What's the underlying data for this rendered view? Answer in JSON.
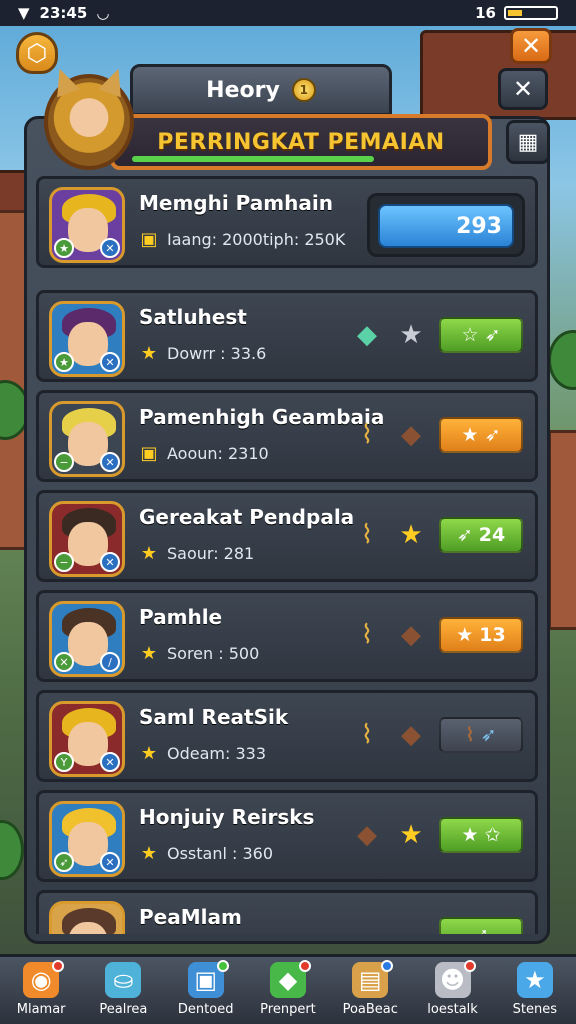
{
  "status_bar": {
    "left": "23:45",
    "right": "16"
  },
  "header": {
    "tab_title": "Heory",
    "tab_coin": "1",
    "banner_title": "PERRINGKAT PEMAIAN"
  },
  "players": [
    {
      "name": "Memghi Pamhain",
      "stat_label": "Iaang: 2000tiph: 250K",
      "score": "293",
      "hair": "#e7b51d"
    },
    {
      "name": "Satluhest",
      "stat_label": "Dowrr : 33.6",
      "pill": "",
      "hair": "#5b2a6a"
    },
    {
      "name": "Pamenhigh Geambaia",
      "stat_label": "Aooun: 2310",
      "pill": "",
      "hair": "#e6d04a"
    },
    {
      "name": "Gereakat Pendpala",
      "stat_label": "Saour: 281",
      "pill": "24",
      "hair": "#3a2a22"
    },
    {
      "name": "Pamhle",
      "stat_label": "Soren : 500",
      "pill": "13",
      "hair": "#4a3224"
    },
    {
      "name": "Saml ReatSik",
      "stat_label": "Odeam: 333",
      "pill": "",
      "hair": "#e7b51d"
    },
    {
      "name": "Honjuiy Reirsks",
      "stat_label": "Osstanl : 360",
      "pill": "",
      "hair": "#f1c02d"
    },
    {
      "name": "PeaMlam",
      "stat_label": "",
      "pill": "",
      "hair": "#5a3a2a"
    }
  ],
  "nav": [
    {
      "label": "Mlamar",
      "icon": "camera-icon",
      "glyph": "◉",
      "color": "#f08a2a"
    },
    {
      "label": "Pealrea",
      "icon": "pot-icon",
      "glyph": "⛀",
      "color": "#4fb3d9"
    },
    {
      "label": "Dentoed",
      "icon": "map-icon",
      "glyph": "▣",
      "color": "#3f8fd6"
    },
    {
      "label": "Prenpert",
      "icon": "gem-icon",
      "glyph": "◆",
      "color": "#48b848"
    },
    {
      "label": "PoaBeac",
      "icon": "scroll-icon",
      "glyph": "▤",
      "color": "#d9a14a"
    },
    {
      "label": "loestalk",
      "icon": "pet-icon",
      "glyph": "☻",
      "color": "#d8d8d8"
    },
    {
      "label": "Stenes",
      "icon": "star-icon",
      "glyph": "★",
      "color": "#4aa8e8"
    }
  ]
}
